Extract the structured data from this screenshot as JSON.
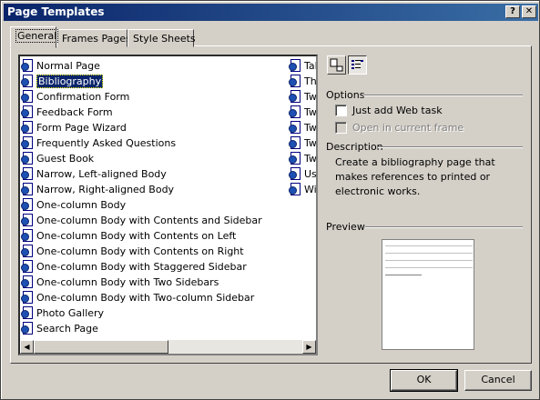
{
  "window": {
    "title": "Page Templates",
    "help_label": "?",
    "close_label": "✕"
  },
  "tabs": [
    {
      "label": "General"
    },
    {
      "label": "Frames Pages"
    },
    {
      "label": "Style Sheets"
    }
  ],
  "templates": [
    {
      "label": "Normal Page"
    },
    {
      "label": "Bibliography"
    },
    {
      "label": "Confirmation Form"
    },
    {
      "label": "Feedback Form"
    },
    {
      "label": "Form Page Wizard"
    },
    {
      "label": "Frequently Asked Questions"
    },
    {
      "label": "Guest Book"
    },
    {
      "label": "Narrow, Left-aligned Body"
    },
    {
      "label": "Narrow, Right-aligned Body"
    },
    {
      "label": "One-column Body"
    },
    {
      "label": "One-column Body with Contents and Sidebar"
    },
    {
      "label": "One-column Body with Contents on Left"
    },
    {
      "label": "One-column Body with Contents on Right"
    },
    {
      "label": "One-column Body with Staggered Sidebar"
    },
    {
      "label": "One-column Body with Two Sidebars"
    },
    {
      "label": "One-column Body with Two-column Sidebar"
    },
    {
      "label": "Photo Gallery"
    },
    {
      "label": "Search Page"
    }
  ],
  "templates_col2": [
    {
      "label": "Tal"
    },
    {
      "label": "Thr"
    },
    {
      "label": "Tw"
    },
    {
      "label": "Tw"
    },
    {
      "label": "Tw"
    },
    {
      "label": "Tw"
    },
    {
      "label": "Tw"
    },
    {
      "label": "Use"
    },
    {
      "label": "Wid"
    }
  ],
  "selected_template": "Bibliography",
  "options": {
    "heading": "Options",
    "just_add_web_task": "Just add Web task",
    "open_in_current_frame": "Open in current frame"
  },
  "description": {
    "heading": "Description",
    "text": "Create a bibliography page that makes references to printed or electronic works."
  },
  "preview": {
    "heading": "Preview"
  },
  "buttons": {
    "ok": "OK",
    "cancel": "Cancel"
  },
  "colors": {
    "title_bar": "#0a246a",
    "selection": "#0a246a",
    "dialog_face": "#d4d0c8"
  },
  "icons": {
    "template": "web-page-icon",
    "large_icons_view": "large-icons-view-icon",
    "list_view": "list-view-icon"
  }
}
